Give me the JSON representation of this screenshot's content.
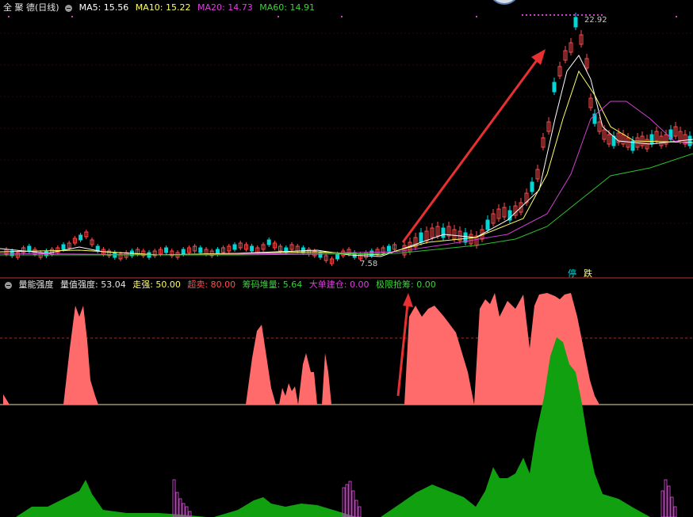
{
  "main_header": {
    "stock": "全 聚 德(日线)",
    "ma5_label": "MA5: 15.56",
    "ma10_label": "MA10: 15.22",
    "ma20_label": "MA20: 14.73",
    "ma60_label": "MA60: 14.91"
  },
  "annotations": {
    "high_label": "22.92",
    "low_label": "7.58"
  },
  "signals": {
    "stop": "停",
    "fall": "跌"
  },
  "indicator_header": {
    "name": "量能强度",
    "strength": "量值强度: 53.04",
    "strong": "走强: 50.00",
    "oversold": "超卖: 80.00",
    "chip": "筹码堆量: 5.64",
    "big_order": "大单建仓: 0.00",
    "grab": "极限抢筹: 0.00"
  },
  "colors": {
    "background": "#000000",
    "up": "#ff4b4b",
    "down": "#00d8d8",
    "ma5": "#ffffff",
    "ma10": "#ffff66",
    "ma20": "#d040d0",
    "ma60": "#30c030",
    "salmon": "#ff6a6a",
    "green_fill": "#10a010",
    "purple_bars": "#c040c0",
    "divider": "#c03030"
  },
  "icons": [
    "collapse-circle-icon",
    "up-arrow-icon"
  ]
}
